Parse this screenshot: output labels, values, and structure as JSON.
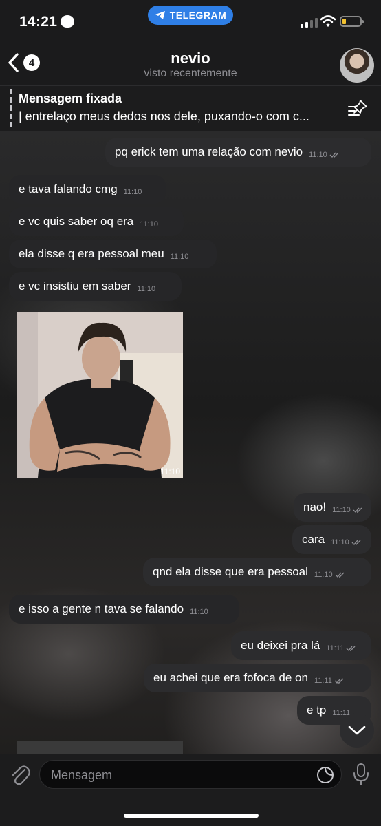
{
  "status_bar": {
    "time": "14:21",
    "pill": "TELEGRAM"
  },
  "header": {
    "back_count": "4",
    "title": "nevio",
    "subtitle": "visto recentemente"
  },
  "pinned": {
    "title": "Mensagem fixada",
    "text": "| entrelaço meus dedos nos dele, puxando-o com c..."
  },
  "messages": [
    {
      "dir": "out",
      "text": "pq erick tem uma relação com nevio",
      "time": "11:10"
    },
    {
      "dir": "in",
      "text": "e tava falando cmg",
      "time": "11:10"
    },
    {
      "dir": "in",
      "text": "e vc quis saber oq era",
      "time": "11:10"
    },
    {
      "dir": "in",
      "text": "ela disse q era pessoal meu",
      "time": "11:10"
    },
    {
      "dir": "in",
      "text": "e vc insistiu em saber",
      "time": "11:10"
    },
    {
      "dir": "in",
      "type": "photo",
      "time": "11:10"
    },
    {
      "dir": "out",
      "text": "nao!",
      "time": "11:10"
    },
    {
      "dir": "out",
      "text": "cara",
      "time": "11:10"
    },
    {
      "dir": "out",
      "text": "qnd ela disse que era pessoal",
      "time": "11:10"
    },
    {
      "dir": "in",
      "text": "e isso a gente n tava se falando",
      "time": "11:10"
    },
    {
      "dir": "out",
      "text": "eu deixei pra lá",
      "time": "11:11"
    },
    {
      "dir": "out",
      "text": "eu achei que era fofoca de on",
      "time": "11:11"
    },
    {
      "dir": "out",
      "text": "e tp",
      "time": "11:11"
    }
  ],
  "composer": {
    "placeholder": "Mensagem"
  },
  "colors": {
    "accent": "#2f7fe6",
    "battery": "#f2c230",
    "bubble": "#262628"
  },
  "icons": [
    "chevron-left-icon",
    "pin-list-icon",
    "attach-icon",
    "sticker-icon",
    "mic-icon",
    "chevron-down-icon",
    "double-check-icon",
    "telegram-icon",
    "wifi-icon",
    "signal-icon",
    "battery-icon"
  ]
}
